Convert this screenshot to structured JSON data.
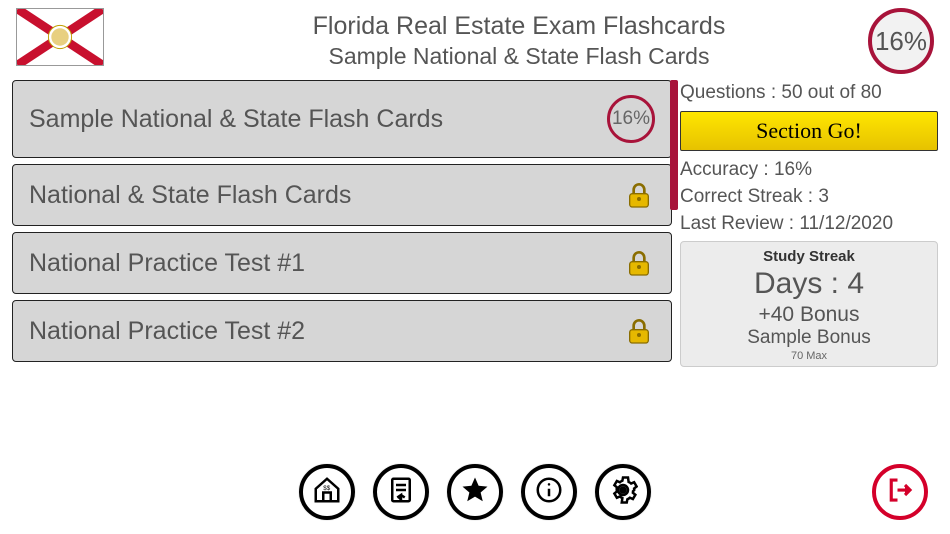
{
  "header": {
    "title_line1": "Florida Real Estate Exam Flashcards",
    "title_line2": "Sample National & State Flash Cards",
    "progress_percent": "16%"
  },
  "cards": [
    {
      "label": "Sample National & State Flash Cards",
      "locked": false,
      "progress": "16%"
    },
    {
      "label": "National & State Flash Cards",
      "locked": true
    },
    {
      "label": "National Practice Test #1",
      "locked": true
    },
    {
      "label": "National Practice Test #2",
      "locked": true
    }
  ],
  "stats": {
    "questions": "Questions : 50 out of 80",
    "section_go": "Section Go!",
    "accuracy": "Accuracy : 16%",
    "correct_streak": "Correct Streak : 3",
    "last_review": "Last Review : 11/12/2020"
  },
  "streak": {
    "title": "Study Streak",
    "days": "Days : 4",
    "bonus": "+40 Bonus",
    "sample": "Sample Bonus",
    "max": "70 Max"
  },
  "nav": {
    "home": "home-icon",
    "report": "report-icon",
    "star": "star-icon",
    "info": "info-icon",
    "settings": "settings-icon",
    "exit": "exit-icon"
  }
}
